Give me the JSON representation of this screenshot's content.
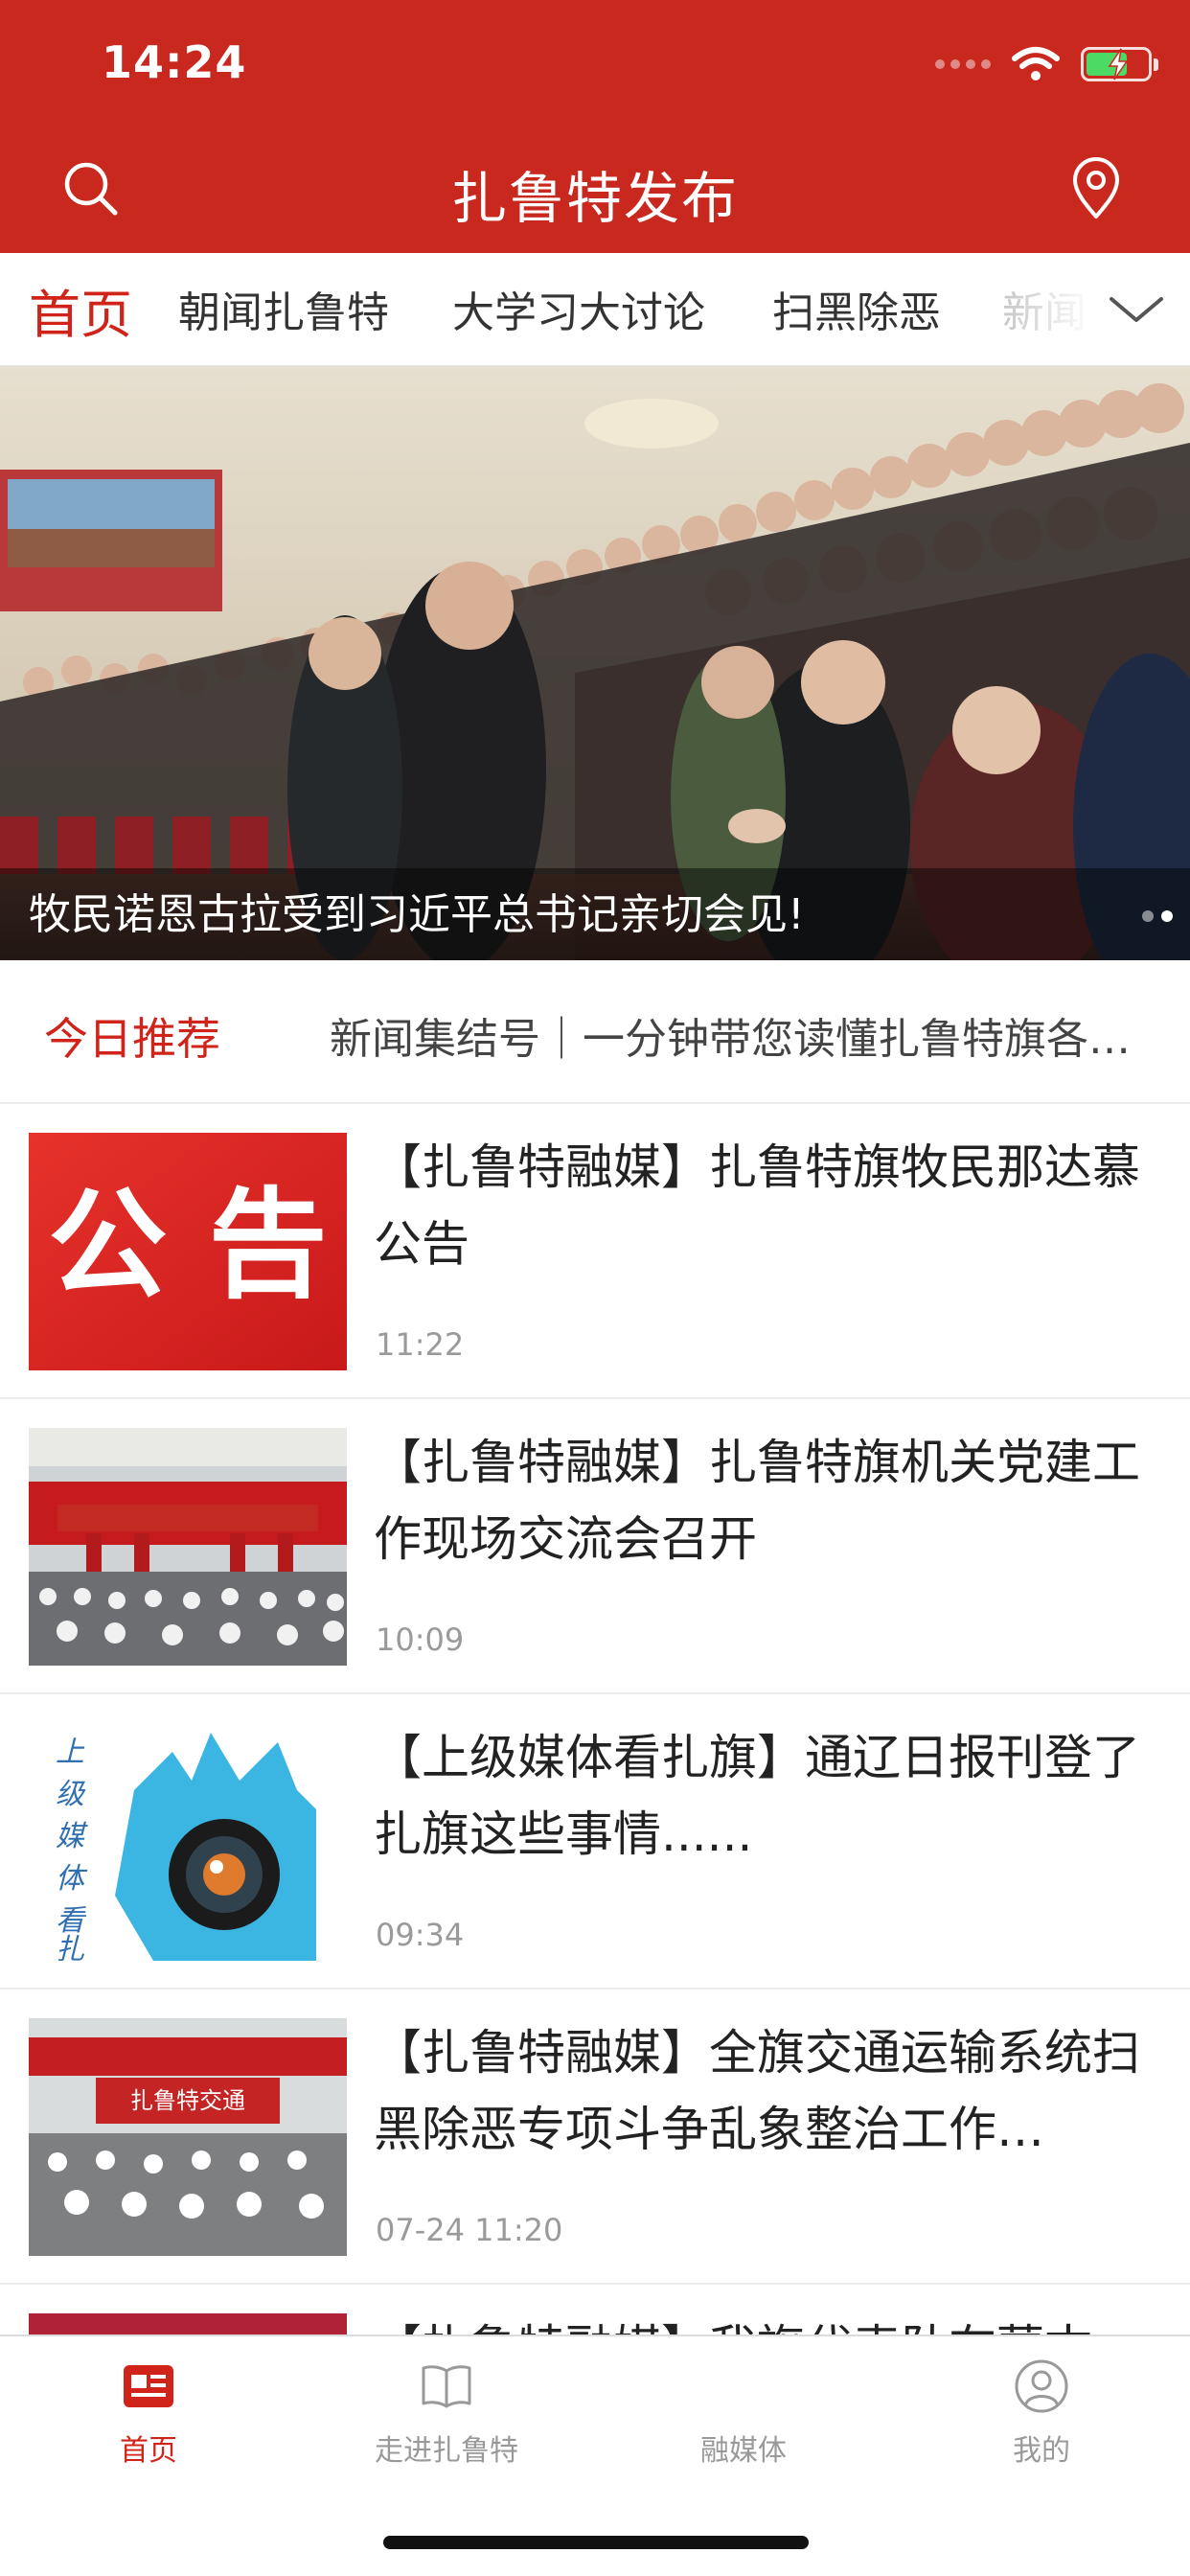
{
  "status_bar": {
    "time": "14:24"
  },
  "nav": {
    "title": "扎鲁特发布"
  },
  "tabs": {
    "items": [
      {
        "label": "首页"
      },
      {
        "label": "朝闻扎鲁特"
      },
      {
        "label": "大学习大讨论"
      },
      {
        "label": "扫黑除恶"
      },
      {
        "label": "新闻"
      }
    ]
  },
  "hero": {
    "caption": "牧民诺恩古拉受到习近平总书记亲切会见!"
  },
  "recommend": {
    "label": "今日推荐",
    "text": "新闻集结号｜一分钟带您读懂扎鲁特旗各…"
  },
  "news": [
    {
      "title": "【扎鲁特融媒】扎鲁特旗牧民那达慕公告",
      "time": "11:22",
      "thumb_text": "公 告"
    },
    {
      "title": "【扎鲁特融媒】扎鲁特旗机关党建工作现场交流会召开",
      "time": "10:09"
    },
    {
      "title": "【上级媒体看扎旗】通辽日报刊登了扎旗这些事情......",
      "time": "09:34",
      "thumb_text": "上级媒体看扎"
    },
    {
      "title": "【扎鲁特融媒】全旗交通运输系统扫黑除恶专项斗争乱象整治工作…",
      "time": "07-24 11:20",
      "thumb_text": "扎鲁特交通"
    },
    {
      "title": "【扎鲁特融媒】我旗代表队在蒙古"
    }
  ],
  "tabbar": {
    "items": [
      {
        "label": "首页"
      },
      {
        "label": "走进扎鲁特"
      },
      {
        "label": "融媒体"
      },
      {
        "label": "我的"
      }
    ]
  },
  "colors": {
    "brand_red": "#c9281f",
    "accent_red": "#d0241b"
  }
}
